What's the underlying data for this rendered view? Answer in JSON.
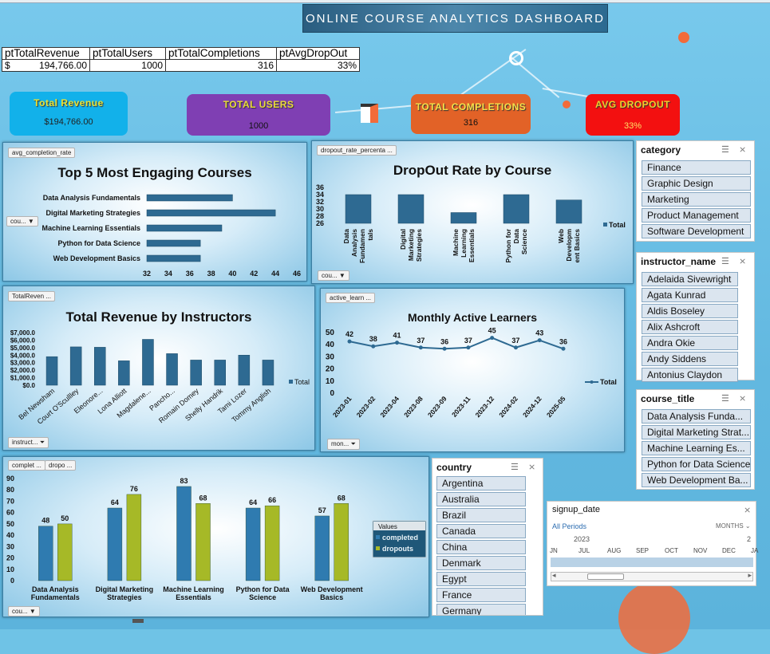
{
  "dashboard_title": "ONLINE COURSE ANALYTICS DASHBOARD",
  "pivot": {
    "headers": [
      "ptTotalRevenue",
      "ptTotalUsers",
      "ptTotalCompletions",
      "ptAvgDropOut"
    ],
    "currency": "$",
    "values": [
      "194,766.00",
      "1000",
      "316",
      "33%"
    ]
  },
  "kpis": [
    {
      "label": "Total Revenue",
      "value": "$194,766.00",
      "bg": "#12b1ea",
      "fg": "#e9e235"
    },
    {
      "label": "TOTAL USERS",
      "value": "1000",
      "bg": "#7f3fb3",
      "fg": "#e9d93a"
    },
    {
      "label": "TOTAL COMPLETIONS",
      "value": "316",
      "bg": "#e26227",
      "fg": "#f5e04a"
    },
    {
      "label": "AVG DROPOUT",
      "value": "33%",
      "bg": "#f31010",
      "fg": "#ead02e"
    }
  ],
  "chart_data": [
    {
      "type": "bar",
      "title": "Top 5 Most Engaging Courses",
      "field_button": "avg_completion_rate",
      "filter_button": "cou...",
      "orientation": "horizontal",
      "categories": [
        "Data Analysis Fundamentals",
        "Digital Marketing Strategies",
        "Machine Learning Essentials",
        "Python for Data Science",
        "Web Development Basics"
      ],
      "values": [
        40,
        44,
        39,
        37,
        37
      ],
      "xlim": [
        32,
        46
      ],
      "xticks": [
        "32",
        "34",
        "36",
        "38",
        "40",
        "42",
        "44",
        "46"
      ],
      "color": "#2e6a92"
    },
    {
      "type": "bar",
      "title": "DropOut Rate by Course",
      "field_button": "dropout_rate_percenta ...",
      "filter_button": "cou...",
      "categories": [
        "Data Analysis Fundamentals",
        "Digital Marketing Strategies",
        "Machine Learning Essentials",
        "Python for Data Science",
        "Web Development Basics"
      ],
      "category_lines": [
        [
          "Data",
          "Analysis",
          "Fundamen",
          "tals"
        ],
        [
          "Digital",
          "Marketing",
          "Strategies"
        ],
        [
          "Machine",
          "Learning",
          "Essentials"
        ],
        [
          "Python for",
          "Data",
          "Science"
        ],
        [
          "Web",
          "Developm",
          "ent Basics"
        ]
      ],
      "series": [
        {
          "name": "Total",
          "values": [
            34,
            34,
            29,
            34,
            32.5
          ]
        }
      ],
      "ylim": [
        26,
        34
      ],
      "yticks": [
        "26",
        "28",
        "30",
        "32",
        "34",
        "36"
      ],
      "legend": "right",
      "color": "#2e6a92"
    },
    {
      "type": "bar",
      "title": "Total Revenue by Instructors",
      "field_button": "TotalReven ...",
      "filter_button": "instruct...",
      "categories": [
        "Bel Newsham",
        "Court O'Scullley",
        "Eleonore...",
        "Lona Alliott",
        "Magdalene...",
        "Pancho...",
        "Romain Domey",
        "Shelly Handrik",
        "Tami Lozer",
        "Tommy Anglish"
      ],
      "series": [
        {
          "name": "Total",
          "values": [
            3800,
            5100,
            5050,
            3250,
            6100,
            4200,
            3350,
            3350,
            4000,
            3350
          ]
        }
      ],
      "ylim": [
        0,
        7000
      ],
      "yticks": [
        "$0.0",
        "$1,000.0",
        "$2,000.0",
        "$3,000.0",
        "$4,000.0",
        "$5,000.0",
        "$6,000.0",
        "$7,000.0"
      ],
      "legend": "right",
      "color": "#2e6a92"
    },
    {
      "type": "line",
      "title": "Monthly Active Learners",
      "field_button": "active_learn ...",
      "filter_button": "mon...",
      "x": [
        "2023-01",
        "2023-02",
        "2023-04",
        "2023-08",
        "2023-09",
        "2023-11",
        "2023-12",
        "2024-02",
        "2024-12",
        "2025-05"
      ],
      "series": [
        {
          "name": "Total",
          "values": [
            42,
            38,
            41,
            37,
            36,
            37,
            45,
            37,
            43,
            36
          ]
        }
      ],
      "ylim": [
        0,
        50
      ],
      "yticks": [
        "0",
        "10",
        "20",
        "30",
        "40",
        "50"
      ],
      "legend": "right",
      "color": "#2e6a92"
    },
    {
      "type": "bar",
      "title": "",
      "field_buttons": [
        "complet ...",
        "dropo ..."
      ],
      "filter_button": "cou...",
      "categories": [
        "Data Analysis Fundamentals",
        "Digital Marketing Strategies",
        "Machine Learning Essentials",
        "Python for Data Science",
        "Web Development Basics"
      ],
      "category_lines": [
        [
          "Data Analysis",
          "Fundamentals"
        ],
        [
          "Digital Marketing",
          "Strategies"
        ],
        [
          "Machine Learning",
          "Essentials"
        ],
        [
          "Python for Data",
          "Science"
        ],
        [
          "Web Development",
          "Basics"
        ]
      ],
      "series": [
        {
          "name": "completed",
          "values": [
            48,
            64,
            83,
            64,
            57
          ],
          "color": "#2f7bb0"
        },
        {
          "name": "dropouts",
          "values": [
            50,
            76,
            68,
            66,
            68
          ],
          "color": "#a6b927"
        }
      ],
      "legend_title": "Values",
      "ylim": [
        0,
        90
      ],
      "yticks": [
        "0",
        "10",
        "20",
        "30",
        "40",
        "50",
        "60",
        "70",
        "80",
        "90"
      ],
      "legend": "right"
    }
  ],
  "slicers": {
    "category": {
      "header": "category",
      "items": [
        "Finance",
        "Graphic Design",
        "Marketing",
        "Product Management",
        "Software Development"
      ]
    },
    "instructor_name": {
      "header": "instructor_name",
      "items": [
        "Adelaida Sivewright",
        "Agata Kunrad",
        "Aldis Boseley",
        "Alix Ashcroft",
        "Andra Okie",
        "Andy Siddens",
        "Antonius Claydon"
      ]
    },
    "course_title": {
      "header": "course_title",
      "items": [
        "Data Analysis Funda...",
        "Digital Marketing Strat...",
        "Machine Learning Es...",
        "Python for Data Science",
        "Web Development Ba..."
      ]
    },
    "country": {
      "header": "country",
      "items": [
        "Argentina",
        "Australia",
        "Brazil",
        "Canada",
        "China",
        "Denmark",
        "Egypt",
        "France",
        "Germany"
      ]
    }
  },
  "timeline": {
    "header": "signup_date",
    "all_periods": "All Periods",
    "level": "MONTHS",
    "year_left": "2023",
    "year_right": "2",
    "months": [
      "JN",
      "JUL",
      "AUG",
      "SEP",
      "OCT",
      "NOV",
      "DEC",
      "JA"
    ]
  }
}
